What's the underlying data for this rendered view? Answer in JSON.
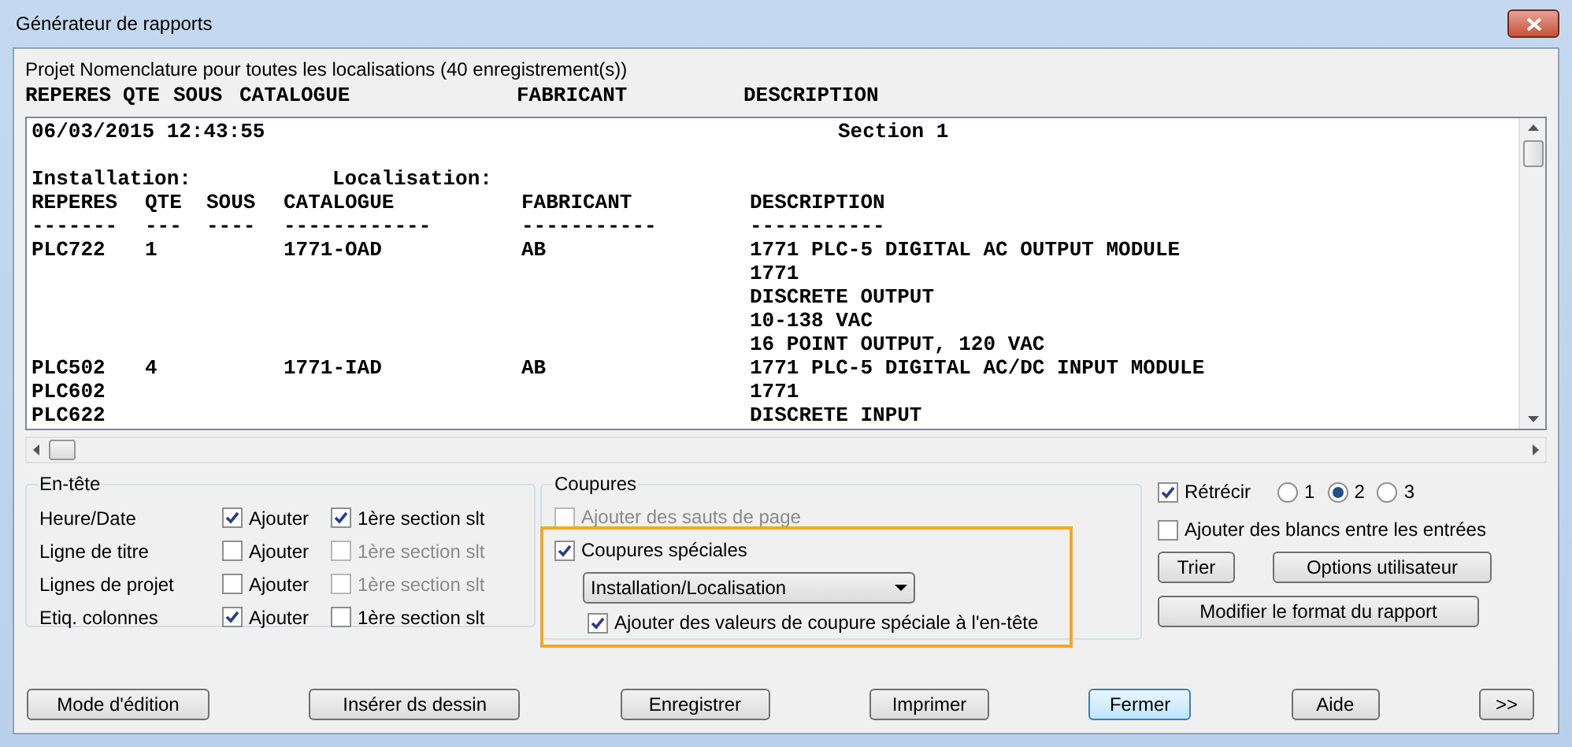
{
  "window": {
    "title": "Générateur de rapports"
  },
  "project_line": "Projet Nomenclature pour toutes les localisations (40 enregistrement(s))",
  "column_headers": [
    "REPERES",
    "QTE",
    "SOUS",
    "CATALOGUE",
    "FABRICANT",
    "DESCRIPTION"
  ],
  "report": {
    "lines": [
      {
        "kind": "stamp",
        "date": "06/03/2015 12:43:55",
        "section": "Section 1"
      },
      {
        "kind": "blank"
      },
      {
        "kind": "labels",
        "installation": "Installation:",
        "localisation": "Localisation:"
      },
      {
        "kind": "row",
        "cells": [
          "REPERES",
          "QTE",
          "SOUS",
          "CATALOGUE",
          "FABRICANT",
          "DESCRIPTION"
        ]
      },
      {
        "kind": "row",
        "cells": [
          "-------",
          "---",
          "----",
          "------------",
          "-----------",
          "-----------"
        ]
      },
      {
        "kind": "row",
        "cells": [
          "PLC722",
          "1",
          null,
          "1771-OAD",
          "AB",
          "1771 PLC-5 DIGITAL AC OUTPUT MODULE"
        ]
      },
      {
        "kind": "row",
        "cells": [
          null,
          null,
          null,
          null,
          null,
          "1771"
        ]
      },
      {
        "kind": "row",
        "cells": [
          null,
          null,
          null,
          null,
          null,
          "DISCRETE OUTPUT"
        ]
      },
      {
        "kind": "row",
        "cells": [
          null,
          null,
          null,
          null,
          null,
          "10-138 VAC"
        ]
      },
      {
        "kind": "row",
        "cells": [
          null,
          null,
          null,
          null,
          null,
          "16 POINT OUTPUT, 120 VAC"
        ]
      },
      {
        "kind": "row",
        "cells": [
          "PLC502",
          "4",
          null,
          "1771-IAD",
          "AB",
          "1771 PLC-5 DIGITAL AC/DC INPUT MODULE"
        ]
      },
      {
        "kind": "row",
        "cells": [
          "PLC602",
          null,
          null,
          null,
          null,
          "1771"
        ]
      },
      {
        "kind": "row",
        "cells": [
          "PLC622",
          null,
          null,
          null,
          null,
          "DISCRETE INPUT"
        ]
      }
    ]
  },
  "entete": {
    "title": "En-tête",
    "rows": [
      {
        "label": "Heure/Date",
        "add": {
          "label": "Ajouter",
          "checked": true
        },
        "first": {
          "label": "1ère section slt",
          "checked": true,
          "disabled": false
        }
      },
      {
        "label": "Ligne de titre",
        "add": {
          "label": "Ajouter",
          "checked": false
        },
        "first": {
          "label": "1ère section slt",
          "checked": false,
          "disabled": true
        }
      },
      {
        "label": "Lignes de projet",
        "add": {
          "label": "Ajouter",
          "checked": false
        },
        "first": {
          "label": "1ère section slt",
          "checked": false,
          "disabled": true
        }
      },
      {
        "label": "Etiq. colonnes",
        "add": {
          "label": "Ajouter",
          "checked": true
        },
        "first": {
          "label": "1ère section slt",
          "checked": false,
          "disabled": false
        }
      }
    ]
  },
  "coupures": {
    "title": "Coupures",
    "highlighted": true,
    "page_breaks": {
      "label": "Ajouter des sauts de page",
      "checked": false,
      "disabled": true
    },
    "special": {
      "label": "Coupures spéciales",
      "checked": true
    },
    "dropdown": {
      "value": "Installation/Localisation"
    },
    "add_values": {
      "label": "Ajouter des valeurs de coupure spéciale à l'en-tête",
      "checked": true
    }
  },
  "options": {
    "shrink": {
      "label": "Rétrécir",
      "checked": true
    },
    "radios": [
      {
        "label": "1",
        "selected": false
      },
      {
        "label": "2",
        "selected": true
      },
      {
        "label": "3",
        "selected": false
      }
    ],
    "blanks": {
      "label": "Ajouter des blancs entre les entrées",
      "checked": false
    },
    "buttons": [
      "Trier",
      "Options utilisateur"
    ],
    "format_button": "Modifier le format du rapport"
  },
  "footer_buttons": [
    {
      "label": "Mode d'édition",
      "focused": false
    },
    {
      "label": "Insérer ds dessin",
      "focused": false
    },
    {
      "label": "Enregistrer",
      "focused": false
    },
    {
      "label": "Imprimer",
      "focused": false
    },
    {
      "label": "Fermer",
      "focused": true
    },
    {
      "label": "Aide",
      "focused": false
    },
    {
      "label": ">>",
      "focused": false
    }
  ]
}
